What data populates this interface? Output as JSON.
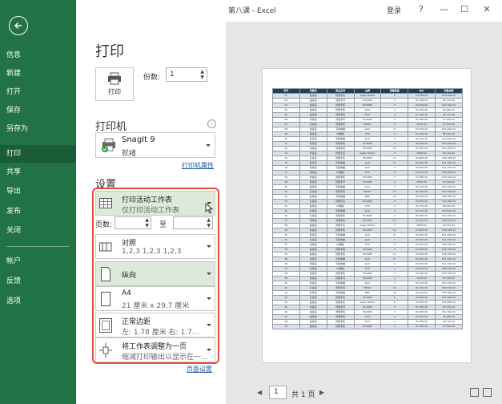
{
  "window": {
    "title": "第八课 - Excel",
    "login": "登录",
    "help": "?",
    "minimize": "—",
    "restore": "☐",
    "close": "✕"
  },
  "sidebar": {
    "items": [
      {
        "label": "信息"
      },
      {
        "label": "新建"
      },
      {
        "label": "打开"
      },
      {
        "label": "保存"
      },
      {
        "label": "另存为"
      },
      {
        "label": "打印"
      },
      {
        "label": "共享"
      },
      {
        "label": "导出"
      },
      {
        "label": "发布"
      },
      {
        "label": "关闭"
      },
      {
        "label": "帐户"
      },
      {
        "label": "反馈"
      },
      {
        "label": "选项"
      }
    ],
    "active": "打印",
    "accent": "#217346"
  },
  "print": {
    "title": "打印",
    "button_label": "打印",
    "copies_label": "份数:",
    "copies_value": "1"
  },
  "printer": {
    "heading": "打印机",
    "name": "SnagIt 9",
    "status": "就绪",
    "properties_link": "打印机属性"
  },
  "settings": {
    "heading": "设置",
    "what": {
      "line1": "打印活动工作表",
      "line2": "仅打印活动工作表"
    },
    "pages_label": "页数:",
    "to_label": "至",
    "collate": {
      "line1": "对照",
      "line2": "1,2,3    1,2,3    1,2,3"
    },
    "orientation": {
      "line1": "纵向"
    },
    "paper": {
      "line1": "A4",
      "line2": "21 厘米 x 29.7 厘米"
    },
    "margins": {
      "line1": "正常边距",
      "line2": "左: 1.78 厘米    右: 1.7..."
    },
    "scaling": {
      "line1": "将工作表调整为一页",
      "line2": "缩减打印输出以显示在一..."
    },
    "page_setup_link": "页面设置"
  },
  "preview": {
    "headers": [
      "序号",
      "销售员",
      "商品名称",
      "品牌",
      "销售数量",
      "单价",
      "销售金额"
    ],
    "rows": [
      [
        "01",
        "赵某某",
        "智能手表",
        "Apple Watch",
        "8",
        "¥3,080.00",
        "¥20,280.00"
      ],
      [
        "02",
        "金某某",
        "智能手环",
        "HUAWEI",
        "3",
        "¥1,580.00",
        "¥4,740.00"
      ],
      [
        "03",
        "金某某",
        "智能手机",
        "HUAWEI",
        "4",
        "¥3,099.00",
        "¥12,396.00"
      ],
      [
        "04",
        "金某某",
        "智能手机",
        "VIVO",
        "2",
        "¥2,030.00",
        "¥5,480.00"
      ],
      [
        "05",
        "金某某",
        "智能手机",
        "VIVO",
        "4",
        "¥1,880.00",
        "¥8,720.00"
      ],
      [
        "06",
        "刘某某",
        "智能手环",
        "HUAWEI",
        "5",
        "¥1,580.00",
        "¥7,900.00"
      ],
      [
        "07",
        "孔某某",
        "智能手机",
        "MEIZU",
        "3",
        "¥876.00",
        "¥7,032.00"
      ],
      [
        "08",
        "金某某",
        "平板电脑",
        "Ipad",
        "6",
        "¥3,590.00",
        "¥21,490.00"
      ],
      [
        "09",
        "金某某",
        "VR眼镜",
        "HTC",
        "4",
        "¥2,230.00",
        "¥8,920.00"
      ],
      [
        "10",
        "赵某某",
        "平板电脑",
        "Ipad",
        "5",
        "¥2,100.00",
        "¥10,500.00"
      ],
      [
        "11",
        "张某某",
        "智能手机",
        "HUAWEI",
        "4",
        "¥2,589.00",
        "¥10,356.00"
      ],
      [
        "12",
        "刘某某",
        "智能手机",
        "HUAWEI",
        "10",
        "¥2,220.00",
        "¥22,200.00"
      ],
      [
        "13",
        "刘某某",
        "智能手表",
        "Apple Watch",
        "4",
        "¥588.00",
        "¥2,352.00"
      ],
      [
        "14",
        "孔某某",
        "智能手机",
        "HUAWEI",
        "12",
        "¥3,899.00",
        "¥46,788.00"
      ],
      [
        "15",
        "赵某某",
        "平板电脑",
        "Ipad",
        "11",
        "¥2,860.00",
        "¥31,460.00"
      ],
      [
        "16",
        "张某某",
        "平板电脑",
        "Ipad",
        "3",
        "¥3,800.00",
        "¥11,400.00"
      ],
      [
        "17",
        "张某某",
        "VR眼镜",
        "HTC",
        "9",
        "¥3,150.00",
        "¥28,350.00"
      ],
      [
        "18",
        "刘某某",
        "智能手机",
        "HUAWEI",
        "3",
        "¥3,580.00",
        "¥10,740.00"
      ],
      [
        "19",
        "张某某",
        "智能手环",
        "HUAWEI",
        "3",
        "¥598.00",
        "¥2,394.00"
      ],
      [
        "20",
        "金某某",
        "平板电脑",
        "Ipad",
        "7",
        "¥2,100.00",
        "¥14,700.00"
      ],
      [
        "21",
        "孔某某",
        "智能手机",
        "MEIZU",
        "15",
        "¥1,580.00",
        "¥23,700.00"
      ],
      [
        "22",
        "赵某某",
        "平板电脑",
        "BBK",
        "22",
        "¥2,400.00",
        "¥58,080.00"
      ],
      [
        "23",
        "孔某某",
        "智能手表",
        "HUAWEI",
        "6",
        "¥3,600.00",
        "¥21,600.00"
      ],
      [
        "24",
        "赵某某",
        "VR眼镜",
        "HTC",
        "4",
        "¥2,230.00",
        "¥8,920.00"
      ],
      [
        "25",
        "刘某某",
        "平板电脑",
        "Ipad",
        "5",
        "¥2,100.00",
        "¥10,500.00"
      ],
      [
        "26",
        "孔某某",
        "智能手机",
        "HUAWEI",
        "4",
        "¥2,589.00",
        "¥10,356.00"
      ],
      [
        "27",
        "张某某",
        "智能手机",
        "HUAWEI",
        "10",
        "¥2,220.00",
        "¥22,200.00"
      ],
      [
        "28",
        "赵某某",
        "智能手表",
        "Apple Watch",
        "4",
        "¥588.00",
        "¥2,352.00"
      ],
      [
        "29",
        "刘某某",
        "智能手机",
        "HUAWEI",
        "12",
        "¥3,899.00",
        "¥46,788.00"
      ],
      [
        "30",
        "张某某",
        "平板电脑",
        "Ipad",
        "11",
        "¥2,860.00",
        "¥31,460.00"
      ],
      [
        "31",
        "孔某某",
        "平板电脑",
        "Ipad",
        "3",
        "¥3,800.00",
        "¥11,400.00"
      ],
      [
        "32",
        "刘某某",
        "VR眼镜",
        "HTC",
        "9",
        "¥3,150.00",
        "¥28,350.00"
      ],
      [
        "33",
        "赵某某",
        "智能手机",
        "HUAWEI",
        "3",
        "¥3,580.00",
        "¥10,740.00"
      ],
      [
        "34",
        "赵某某",
        "智能手机",
        "HUAWEI",
        "12",
        "¥3,899.00",
        "¥46,788.00"
      ],
      [
        "35",
        "刘某某",
        "平板电脑",
        "Ipad",
        "11",
        "¥2,860.00",
        "¥31,460.00"
      ],
      [
        "36",
        "张某某",
        "平板电脑",
        "Ipad",
        "3",
        "¥3,800.00",
        "¥11,400.00"
      ],
      [
        "37",
        "孔某某",
        "VR眼镜",
        "HTC",
        "9",
        "¥3,150.00",
        "¥28,350.00"
      ],
      [
        "38",
        "张某某",
        "智能手机",
        "HUAWEI",
        "3",
        "¥3,580.00",
        "¥10,740.00"
      ],
      [
        "39",
        "张某某",
        "智能手环",
        "HUAWEI",
        "3",
        "¥598.00",
        "¥2,394.00"
      ],
      [
        "40",
        "刘某某",
        "平板电脑",
        "Ipad",
        "7",
        "¥2,100.00",
        "¥14,700.00"
      ],
      [
        "41",
        "孔某某",
        "智能手机",
        "MEIZU",
        "15",
        "¥1,580.00",
        "¥23,700.00"
      ],
      [
        "42",
        "孔某某",
        "平板电脑",
        "BBK",
        "22",
        "¥2,400.00",
        "¥58,080.00"
      ],
      [
        "43",
        "孔某某",
        "智能手表",
        "HUAWEI",
        "6",
        "¥3,600.00",
        "¥21,600.00"
      ],
      [
        "44",
        "金某某",
        "智能手表",
        "Apple Watch",
        "8",
        "¥3,080.00",
        "¥20,280.00"
      ],
      [
        "45",
        "刘某某",
        "智能手环",
        "HUAWEI",
        "3",
        "¥1,580.00",
        "¥4,740.00"
      ],
      [
        "46",
        "金某某",
        "智能手机",
        "HUAWEI",
        "4",
        "¥3,099.00",
        "¥12,396.00"
      ],
      [
        "47",
        "金某某",
        "智能手机",
        "VIVO",
        "2",
        "¥2,030.00",
        "¥5,480.00"
      ],
      [
        "48",
        "金某某",
        "智能手机",
        "VIVO",
        "4",
        "¥1,880.00",
        "¥8,720.00"
      ],
      [
        "49",
        "金某某",
        "智能手机",
        "HUAWEI",
        "5",
        "¥1,580.00",
        "¥7,900.00"
      ]
    ],
    "current_page": "1",
    "total_pages": "共 1 页",
    "prev": "◀",
    "next": "▶"
  }
}
